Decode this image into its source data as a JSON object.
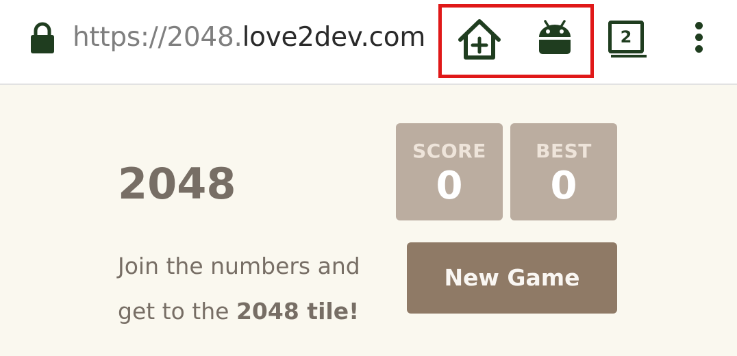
{
  "browser": {
    "url_scheme": "https://",
    "url_subdomain": "2048.",
    "url_host": "love2dev.com",
    "tab_count": "2",
    "icon_color": "#1f3d1f",
    "highlight_color": "#e01818",
    "icons": {
      "lock": "lock-icon",
      "add_to_home": "add-to-home-screen-icon",
      "android": "android-icon",
      "tabs": "tab-switcher-icon",
      "menu": "more-vert-icon"
    }
  },
  "game": {
    "title": "2048",
    "score_label": "SCORE",
    "score_value": "0",
    "best_label": "BEST",
    "best_value": "0",
    "intro_line1": "Join the numbers and",
    "intro_line2_prefix": "get to the",
    "intro_line2_strong": "2048 tile!",
    "new_game_label": "New Game",
    "colors": {
      "background": "#faf8ef",
      "text": "#776e65",
      "score_box": "#bbada0",
      "score_label": "#eee4da",
      "button": "#8f7a66",
      "button_text": "#f9f6f2"
    }
  }
}
